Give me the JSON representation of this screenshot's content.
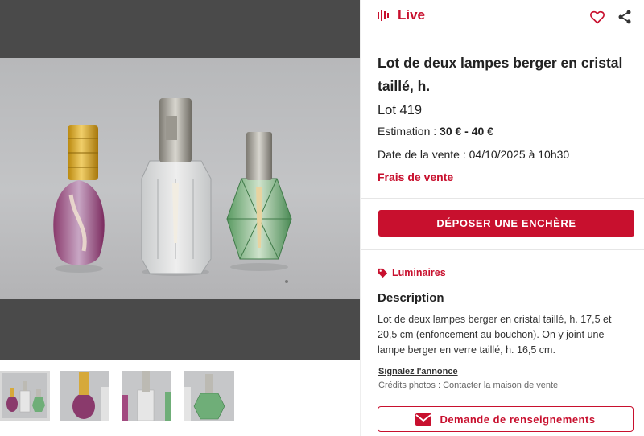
{
  "header": {
    "live_label": "Live"
  },
  "lot": {
    "title": "Lot de deux lampes berger en cristal taillé, h.",
    "number": "Lot 419",
    "estimate_prefix": "Estimation : ",
    "estimate_value": "30 € - 40 €",
    "sale_date": "Date de la vente : 04/10/2025 à 10h30",
    "fees_link": "Frais de vente"
  },
  "actions": {
    "bid_button": "DÉPOSER UNE ENCHÈRE",
    "info_button": "Demande de renseignements"
  },
  "details": {
    "category": "Luminaires",
    "description_heading": "Description",
    "description": "Lot de deux lampes berger en cristal taillé, h. 17,5 et 20,5 cm (enfoncement au bouchon). On y joint une lampe berger en verre taillé, h. 16,5 cm.",
    "report_link": "Signalez l'annonce",
    "credits": "Crédits photos : Contacter la maison de vente"
  },
  "gallery": {
    "thumbnail_count": 4,
    "active_index": 0
  },
  "colors": {
    "accent": "#c8102e",
    "viewer_bg": "#4a4a4a"
  },
  "icons": [
    "live-broadcast-icon",
    "heart-icon",
    "share-icon",
    "tag-icon",
    "mail-icon"
  ]
}
